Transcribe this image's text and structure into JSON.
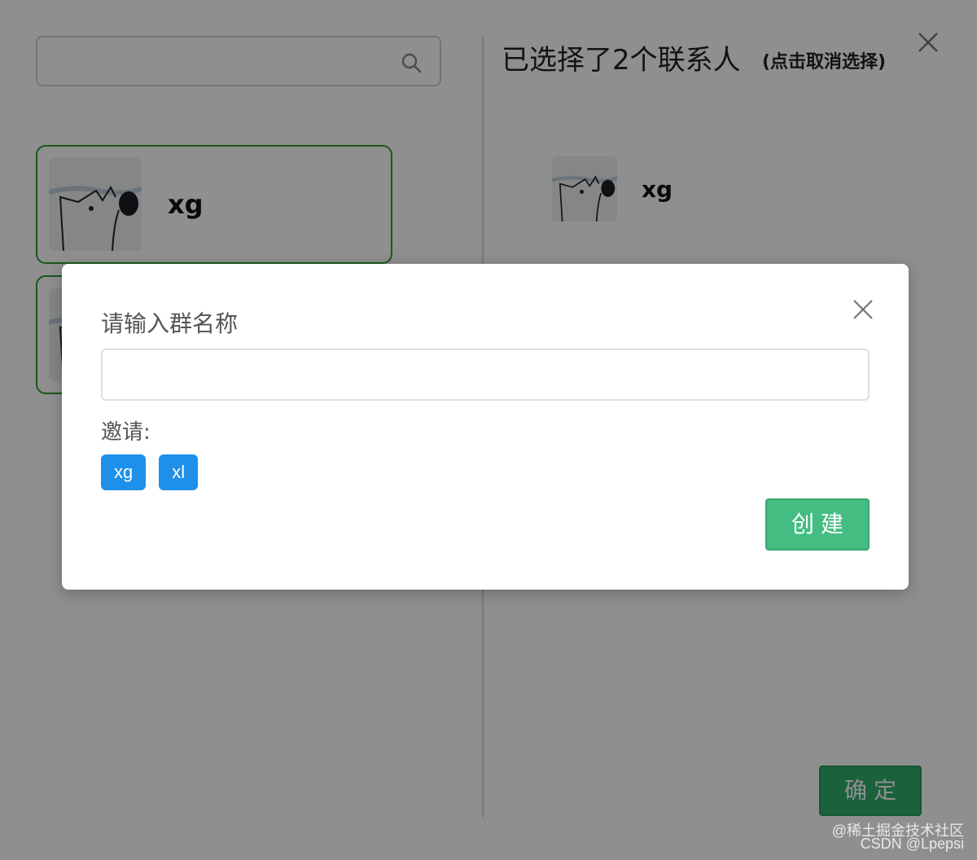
{
  "picker": {
    "search": {
      "value": "",
      "icon": "search-icon"
    },
    "contacts": [
      {
        "name": "xg"
      },
      {
        "name": ""
      }
    ],
    "selected": {
      "title": "已选择了2个联系人",
      "hint": "(点击取消选择)",
      "items": [
        {
          "name": "xg"
        }
      ]
    },
    "confirm_label": "确定"
  },
  "dialog": {
    "title": "请输入群名称",
    "input_value": "",
    "invite_label": "邀请:",
    "invitees": [
      "xg",
      "xl"
    ],
    "create_label": "创建"
  },
  "watermark": {
    "line1": "@稀土掘金技术社区",
    "line2": "CSDN @Lpepsi"
  },
  "colors": {
    "create_button": "#45bd82",
    "confirm_button": "#2fae6b",
    "invite_tag": "#1e90e9",
    "card_border": "#2e9e2e"
  }
}
